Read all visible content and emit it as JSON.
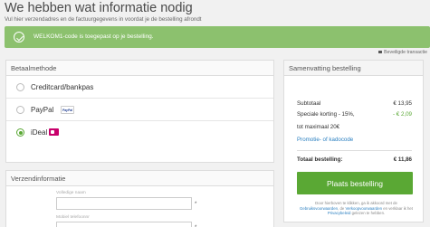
{
  "header": {
    "title": "We hebben wat informatie nodig",
    "subtitle": "Vul hier verzendadres en de factuurgegevens in voordat je de bestelling afrondt"
  },
  "alert": {
    "message": "WELKOM1-code is toegepast op je bestelling.",
    "icon": "check-circle-icon",
    "color": "#8cc16e"
  },
  "secure_text": "Beveiligde transactie",
  "payment": {
    "title": "Betaalmethode",
    "options": [
      {
        "label": "Creditcard/bankpas",
        "selected": false
      },
      {
        "label": "PayPal",
        "selected": false,
        "logo_text": "PayPal"
      },
      {
        "label": "iDeal",
        "selected": true
      }
    ],
    "accent": "#5aa834"
  },
  "shipping": {
    "title": "Verzendinformatie",
    "fields": [
      {
        "label": "Volledige naam",
        "value": "",
        "required_mark": "*"
      },
      {
        "label": "Mobiel telefoonnr",
        "value": "",
        "required_mark": "*"
      }
    ]
  },
  "summary": {
    "title": "Samenvatting bestelling",
    "subtotal_label": "Subtotaal",
    "subtotal_value": "€ 13,95",
    "discount_label": "Speciale korting - 15%,",
    "discount_label_2": "tot maximaal 20€",
    "discount_value": "- € 2,09",
    "promo_link": "Promotie- of kadocode",
    "total_label": "Totaal bestelling:",
    "total_value": "€ 11,86",
    "place_order_button": "Plaats bestelling",
    "legal_pre": "Door hierboven te klikken, ga ik akkoord met de",
    "legal_link_1": "Gebruiksvoorwaarden",
    "legal_mid": ", de",
    "legal_link_2": "Verkoopvoorwaarden",
    "legal_mid_2": "en",
    "legal_pre_2": "verklaar ik het",
    "legal_link_3": "Privacybeleid",
    "legal_post": "gelezen te hebben."
  }
}
